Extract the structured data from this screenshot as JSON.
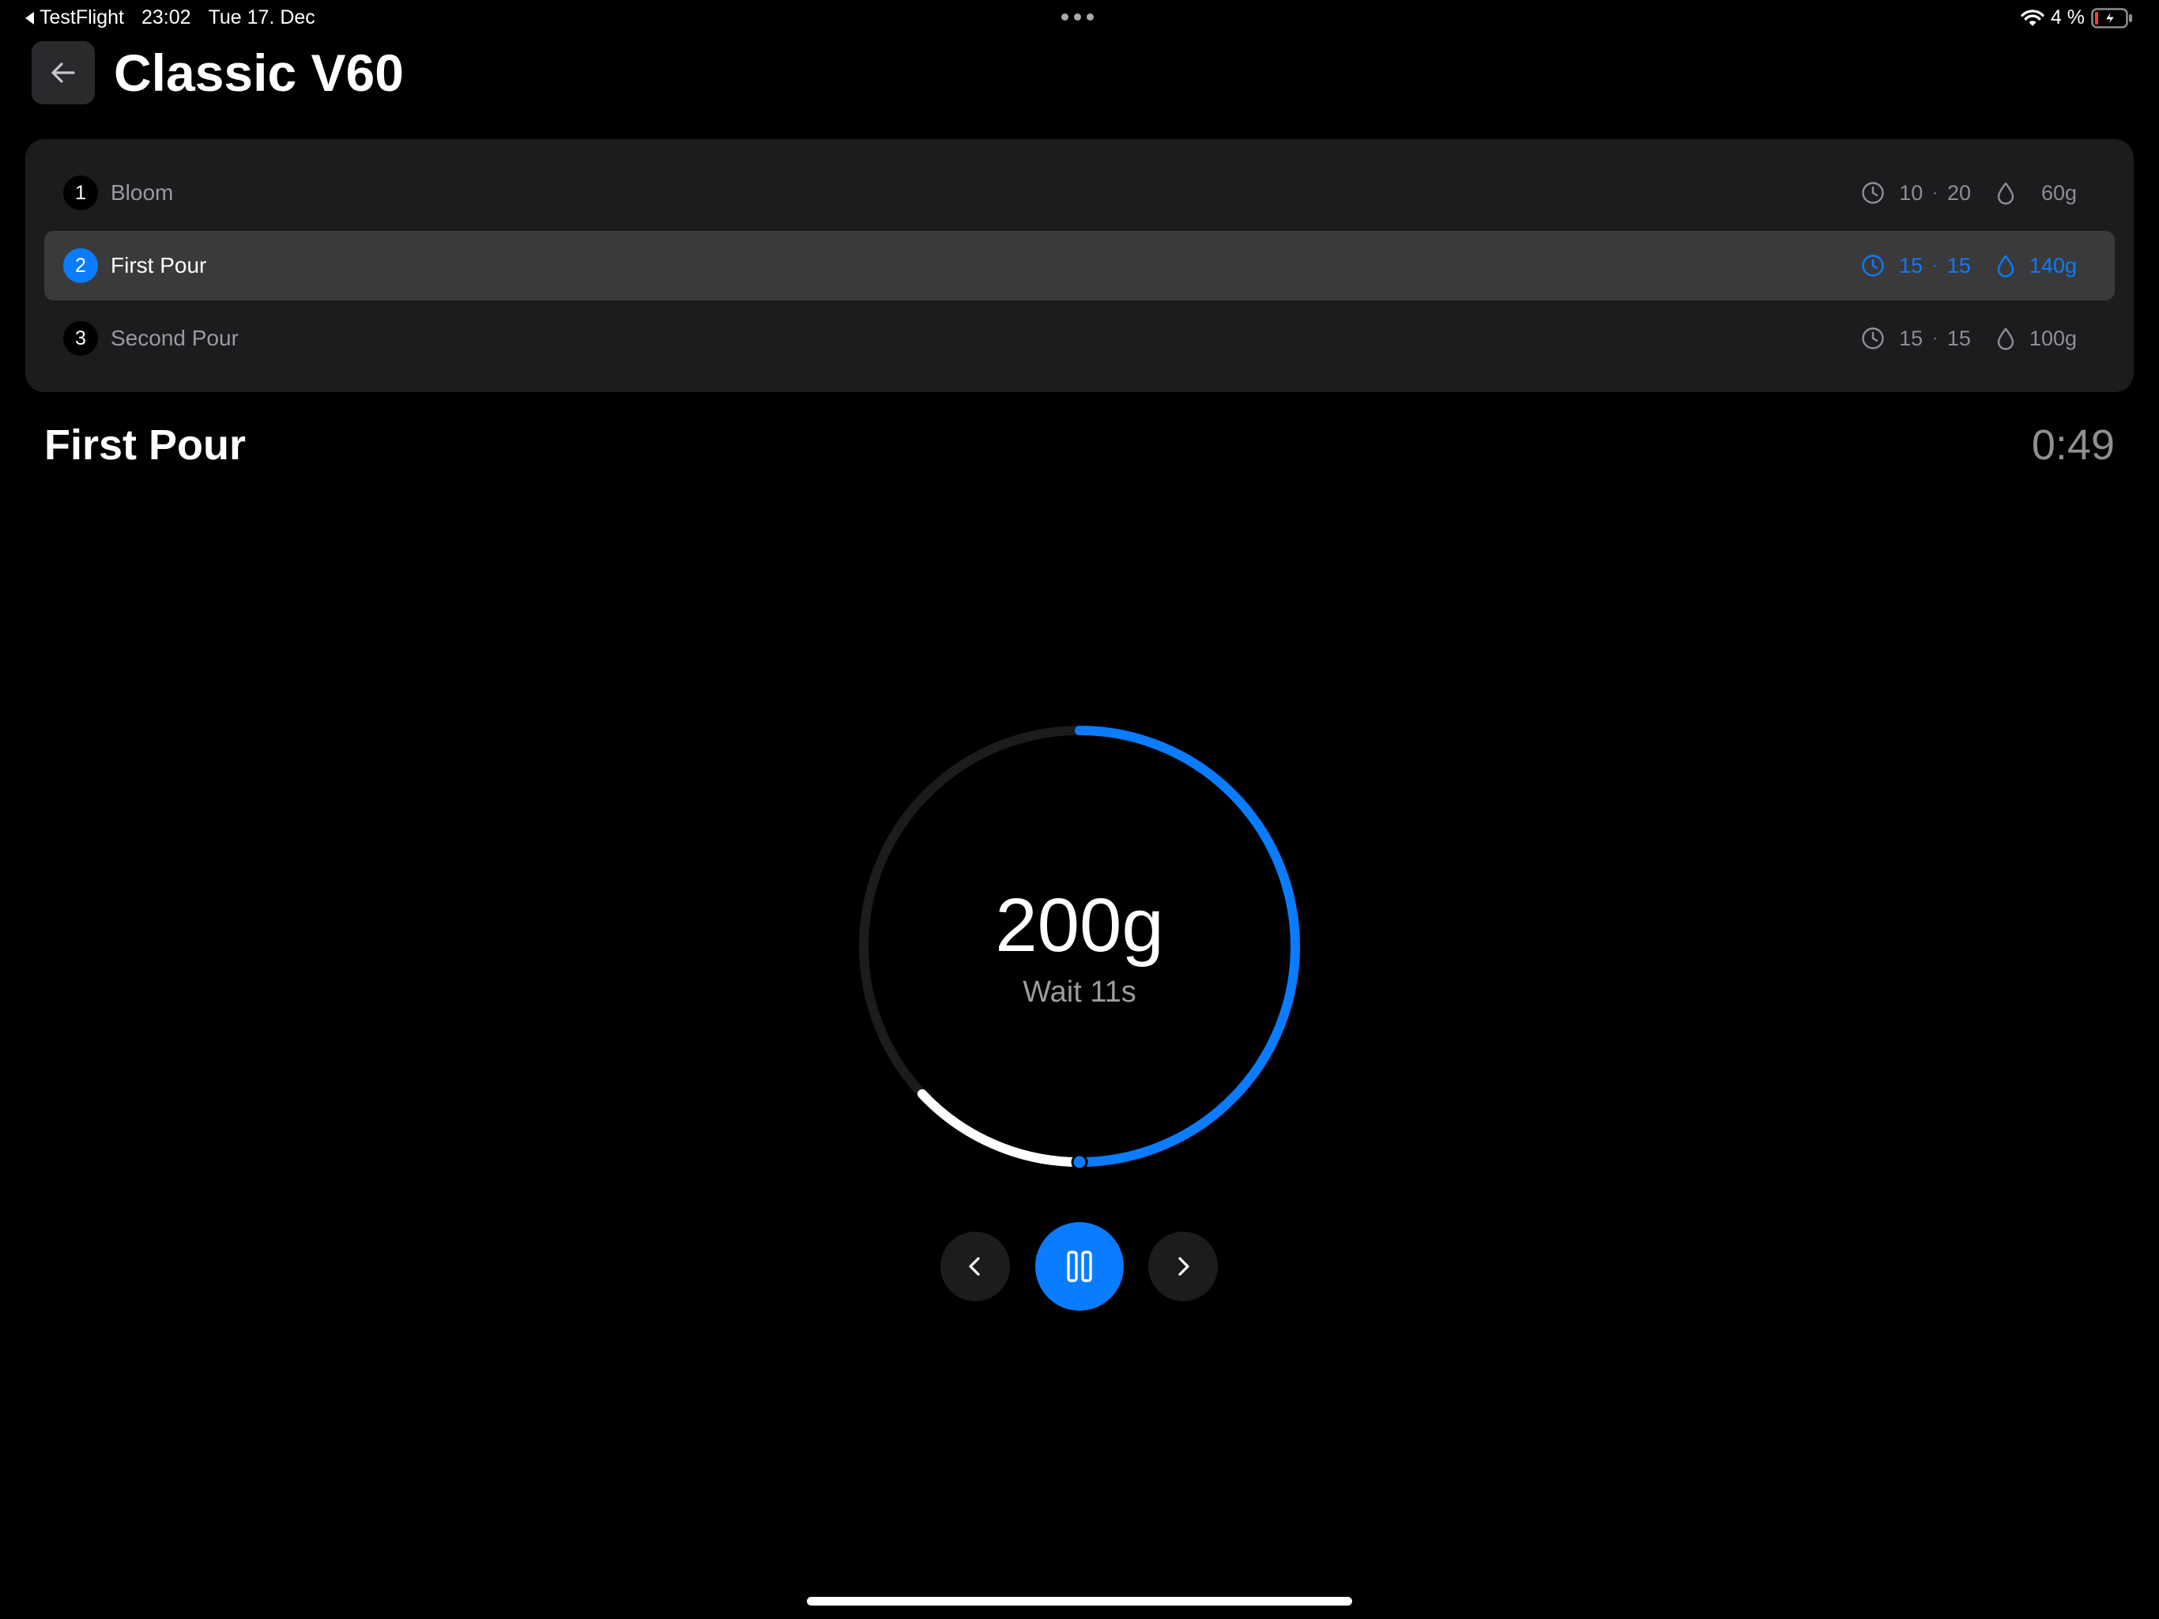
{
  "status_bar": {
    "back_app": "TestFlight",
    "time": "23:02",
    "date": "Tue 17. Dec",
    "battery": "4 %"
  },
  "header": {
    "title": "Classic V60",
    "back_icon": "arrow-left-icon"
  },
  "steps": [
    {
      "number": "1",
      "name": "Bloom",
      "time_a": "10",
      "time_b": "20",
      "water": "60g"
    },
    {
      "number": "2",
      "name": "First Pour",
      "time_a": "15",
      "time_b": "15",
      "water": "140g"
    },
    {
      "number": "3",
      "name": "Second Pour",
      "time_a": "15",
      "time_b": "15",
      "water": "100g"
    }
  ],
  "active_step_index": 1,
  "current": {
    "step_name": "First Pour",
    "elapsed": "0:49",
    "target_weight": "200g",
    "wait_text": "Wait 11s",
    "pour_progress": 0.5,
    "wait_progress": 0.13
  },
  "controls": {
    "prev_icon": "chevron-left-icon",
    "pause_icon": "pause-icon",
    "next_icon": "chevron-right-icon"
  },
  "colors": {
    "accent": "#0a7cff",
    "background": "#000000",
    "card": "#1c1c1e",
    "active_row": "#3a3a3c",
    "muted_text": "#8e8e93"
  }
}
